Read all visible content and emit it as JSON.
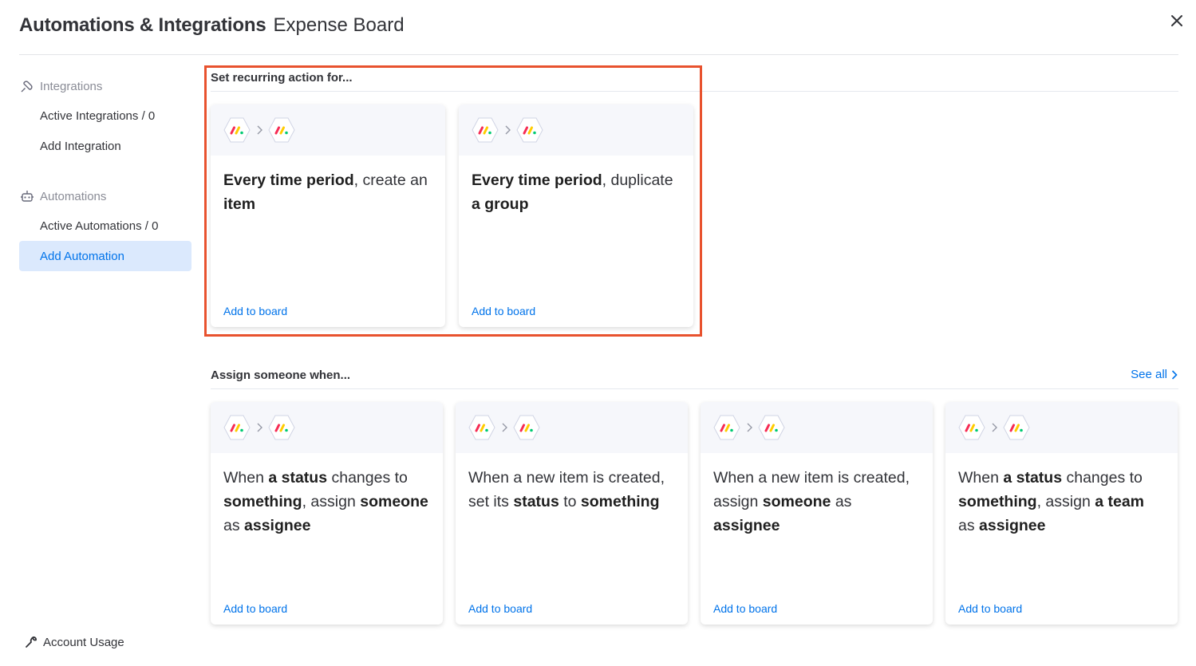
{
  "header": {
    "title": "Automations & Integrations",
    "subtitle": "Expense Board",
    "close_icon": "close-icon"
  },
  "sidebar": {
    "integrations": {
      "title": "Integrations",
      "icon": "plug-icon",
      "items": [
        {
          "label": "Active Integrations / 0"
        },
        {
          "label": "Add Integration"
        }
      ]
    },
    "automations": {
      "title": "Automations",
      "icon": "robot-icon",
      "items": [
        {
          "label": "Active Automations / 0"
        },
        {
          "label": "Add Automation",
          "active": true
        }
      ]
    },
    "account_usage": {
      "label": "Account Usage",
      "icon": "wrench-icon"
    }
  },
  "sections": {
    "recurring": {
      "title": "Set recurring action for...",
      "cards": [
        {
          "parts": [
            {
              "t": "Every time period",
              "b": true
            },
            {
              "t": ", create an ",
              "b": false
            },
            {
              "t": "item",
              "b": true
            }
          ],
          "add_label": "Add to board"
        },
        {
          "parts": [
            {
              "t": "Every time period",
              "b": true
            },
            {
              "t": ", duplicate ",
              "b": false
            },
            {
              "t": "a group",
              "b": true
            }
          ],
          "add_label": "Add to board"
        }
      ]
    },
    "assign": {
      "title": "Assign someone when...",
      "see_all": "See all",
      "cards": [
        {
          "parts": [
            {
              "t": "When ",
              "b": false
            },
            {
              "t": "a status",
              "b": true
            },
            {
              "t": " changes to ",
              "b": false
            },
            {
              "t": "something",
              "b": true
            },
            {
              "t": ", assign ",
              "b": false
            },
            {
              "t": "someone",
              "b": true
            },
            {
              "t": " as ",
              "b": false
            },
            {
              "t": "assignee",
              "b": true
            }
          ],
          "add_label": "Add to board"
        },
        {
          "parts": [
            {
              "t": "When a new item is created, set its ",
              "b": false
            },
            {
              "t": "status",
              "b": true
            },
            {
              "t": " to ",
              "b": false
            },
            {
              "t": "something",
              "b": true
            }
          ],
          "add_label": "Add to board"
        },
        {
          "parts": [
            {
              "t": "When a new item is created, assign ",
              "b": false
            },
            {
              "t": "someone",
              "b": true
            },
            {
              "t": " as ",
              "b": false
            },
            {
              "t": "assignee",
              "b": true
            }
          ],
          "add_label": "Add to board"
        },
        {
          "parts": [
            {
              "t": "When ",
              "b": false
            },
            {
              "t": "a status",
              "b": true
            },
            {
              "t": " changes to ",
              "b": false
            },
            {
              "t": "something",
              "b": true
            },
            {
              "t": ", assign ",
              "b": false
            },
            {
              "t": "a team",
              "b": true
            },
            {
              "t": " as ",
              "b": false
            },
            {
              "t": "assignee",
              "b": true
            }
          ],
          "add_label": "Add to board"
        }
      ]
    }
  },
  "colors": {
    "accent": "#0073ea",
    "active_bg": "#dbe9fd",
    "highlight": "#e8522e",
    "logo_red": "#f62b54",
    "logo_yellow": "#ffcc00",
    "logo_green": "#00ca72"
  }
}
